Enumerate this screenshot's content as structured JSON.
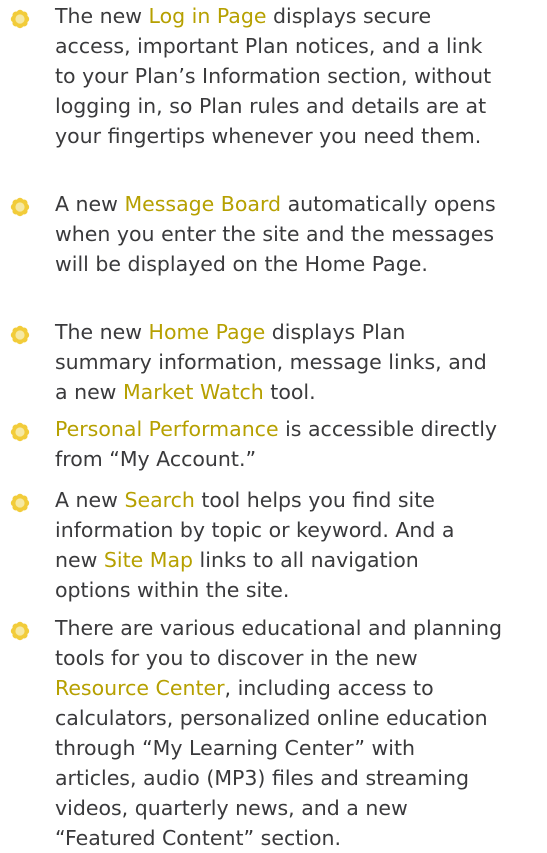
{
  "colors": {
    "text": "#3a3a3c",
    "highlight": "#b6a000",
    "bullet_petal": "#f2cc3a",
    "bullet_center": "#f6e9a4"
  },
  "bullet_icon": "yellow-flower-icon",
  "items": [
    {
      "lines": [
        [
          {
            "t": "The new "
          },
          {
            "t": "Log in Page",
            "hl": true
          },
          {
            "t": " displays secure"
          }
        ],
        [
          {
            "t": "access, important Plan notices, and a link"
          }
        ],
        [
          {
            "t": "to your Plan’s Information section, without"
          }
        ],
        [
          {
            "t": "logging in, so Plan rules and details are at"
          }
        ],
        [
          {
            "t": "your fingertips whenever you need them."
          }
        ]
      ]
    },
    {
      "lines": [
        [
          {
            "t": "A new "
          },
          {
            "t": "Message Board",
            "hl": true
          },
          {
            "t": " automatically opens"
          }
        ],
        [
          {
            "t": "when you enter the site and the messages"
          }
        ],
        [
          {
            "t": "will be displayed on the Home Page."
          }
        ]
      ]
    },
    {
      "lines": [
        [
          {
            "t": "The new "
          },
          {
            "t": "Home Page",
            "hl": true
          },
          {
            "t": " displays Plan"
          }
        ],
        [
          {
            "t": "summary information, message links, and"
          }
        ],
        [
          {
            "t": "a new "
          },
          {
            "t": "Market Watch",
            "hl": true
          },
          {
            "t": " tool."
          }
        ]
      ]
    },
    {
      "lines": [
        [
          {
            "t": "Personal Performance",
            "hl": true
          },
          {
            "t": " is accessible directly"
          }
        ],
        [
          {
            "t": "from “My Account.”"
          }
        ]
      ]
    },
    {
      "lines": [
        [
          {
            "t": "A new "
          },
          {
            "t": "Search",
            "hl": true
          },
          {
            "t": " tool helps you find site"
          }
        ],
        [
          {
            "t": "information by topic or keyword. And a"
          }
        ],
        [
          {
            "t": "new "
          },
          {
            "t": "Site Map",
            "hl": true
          },
          {
            "t": " links to all navigation"
          }
        ],
        [
          {
            "t": "options within the site."
          }
        ]
      ]
    },
    {
      "lines": [
        [
          {
            "t": "There are various educational and planning"
          }
        ],
        [
          {
            "t": "tools for you to discover in the new"
          }
        ],
        [
          {
            "t": "Resource Center",
            "hl": true
          },
          {
            "t": ", including access to"
          }
        ],
        [
          {
            "t": "calculators, personalized online education"
          }
        ],
        [
          {
            "t": "through “My Learning Center” with"
          }
        ],
        [
          {
            "t": "articles, audio (MP3) files and streaming"
          }
        ],
        [
          {
            "t": "videos, quarterly news, and a new"
          }
        ],
        [
          {
            "t": "“Featured Content” section."
          }
        ]
      ]
    }
  ]
}
